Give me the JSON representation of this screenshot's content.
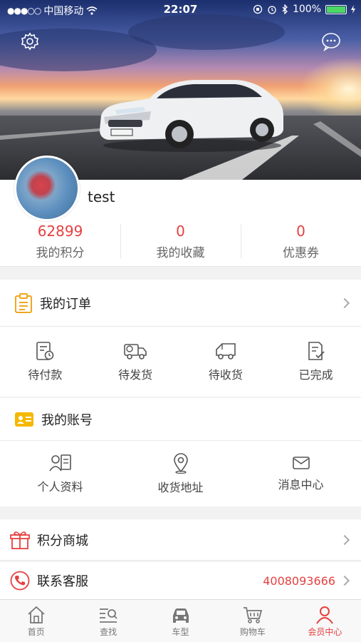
{
  "status_bar": {
    "signal": "●●●○○",
    "carrier": "中国移动",
    "time": "22:07",
    "battery": "100%"
  },
  "profile": {
    "username": "test",
    "stats": [
      {
        "value": "62899",
        "label": "我的积分"
      },
      {
        "value": "0",
        "label": "我的收藏"
      },
      {
        "value": "0",
        "label": "优惠券"
      }
    ]
  },
  "orders": {
    "title": "我的订单",
    "items": [
      {
        "label": "待付款",
        "icon": "pending-payment-icon"
      },
      {
        "label": "待发货",
        "icon": "truck-icon"
      },
      {
        "label": "待收货",
        "icon": "delivery-icon"
      },
      {
        "label": "已完成",
        "icon": "completed-icon"
      }
    ]
  },
  "account": {
    "title": "我的账号",
    "items": [
      {
        "label": "个人资料",
        "icon": "profile-card-icon"
      },
      {
        "label": "收货地址",
        "icon": "location-pin-icon"
      },
      {
        "label": "消息中心",
        "icon": "mail-icon"
      }
    ]
  },
  "points_mall": {
    "title": "积分商城"
  },
  "customer_service": {
    "title": "联系客服",
    "phone": "4008093666"
  },
  "tabbar": {
    "items": [
      {
        "label": "首页",
        "icon": "home-icon"
      },
      {
        "label": "查找",
        "icon": "search-list-icon"
      },
      {
        "label": "车型",
        "icon": "car-icon"
      },
      {
        "label": "购物车",
        "icon": "cart-icon"
      },
      {
        "label": "会员中心",
        "icon": "user-icon"
      }
    ],
    "active_index": 4
  },
  "colors": {
    "accent": "#e64040",
    "order_icon": "#f0a81e",
    "account_icon": "#f5b800"
  }
}
